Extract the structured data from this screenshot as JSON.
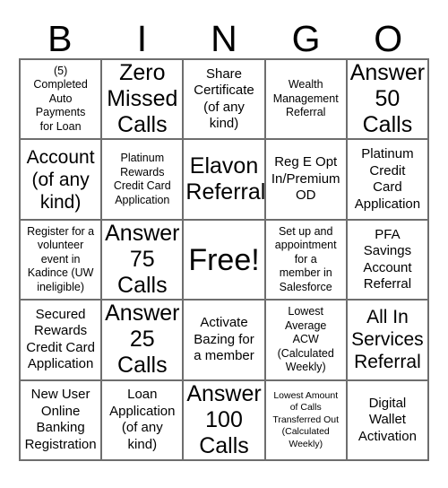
{
  "card": {
    "header_letters": [
      "B",
      "I",
      "N",
      "G",
      "O"
    ],
    "grid_line_color": "#6e6e6e",
    "text_color": "#000000",
    "background_color": "#ffffff",
    "rows": [
      [
        {
          "text": "(5)\nCompleted\nAuto\nPayments\nfor Loan",
          "size": "s"
        },
        {
          "text": "Zero\nMissed\nCalls",
          "size": "xl"
        },
        {
          "text": "Share\nCertificate\n(of any\nkind)",
          "size": "m"
        },
        {
          "text": "Wealth\nManagement\nReferral",
          "size": "s"
        },
        {
          "text": "Answer\n50\nCalls",
          "size": "xl"
        }
      ],
      [
        {
          "text": "Account\n(of any\nkind)",
          "size": "l"
        },
        {
          "text": "Platinum\nRewards\nCredit Card\nApplication",
          "size": "s"
        },
        {
          "text": "Elavon\nReferral",
          "size": "xl"
        },
        {
          "text": "Reg E Opt\nIn/Premium\nOD",
          "size": "m"
        },
        {
          "text": "Platinum\nCredit\nCard\nApplication",
          "size": "m"
        }
      ],
      [
        {
          "text": "Register for a\nvolunteer\nevent in\nKadince (UW\nineligible)",
          "size": "s"
        },
        {
          "text": "Answer\n75\nCalls",
          "size": "xl"
        },
        {
          "text": "Free!",
          "size": "free"
        },
        {
          "text": "Set up and\nappointment\nfor a\nmember in\nSalesforce",
          "size": "s"
        },
        {
          "text": "PFA\nSavings\nAccount\nReferral",
          "size": "m"
        }
      ],
      [
        {
          "text": "Secured\nRewards\nCredit Card\nApplication",
          "size": "m"
        },
        {
          "text": "Answer\n25\nCalls",
          "size": "xl"
        },
        {
          "text": "Activate\nBazing for\na member",
          "size": "m"
        },
        {
          "text": "Lowest\nAverage\nACW\n(Calculated\nWeekly)",
          "size": "s"
        },
        {
          "text": "All In\nServices\nReferral",
          "size": "l"
        }
      ],
      [
        {
          "text": "New User\nOnline\nBanking\nRegistration",
          "size": "m"
        },
        {
          "text": "Loan\nApplication\n(of any\nkind)",
          "size": "m"
        },
        {
          "text": "Answer\n100\nCalls",
          "size": "xl"
        },
        {
          "text": "Lowest Amount\nof Calls\nTransferred Out\n(Calculated\nWeekly)",
          "size": "xs"
        },
        {
          "text": "Digital\nWallet\nActivation",
          "size": "m"
        }
      ]
    ]
  }
}
